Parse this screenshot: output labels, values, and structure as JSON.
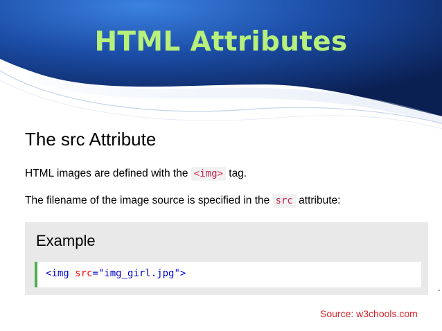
{
  "slide": {
    "title": "HTML Attributes",
    "source": "Source: w3chools.com",
    "edge_mark": "-"
  },
  "content": {
    "heading": "The src Attribute",
    "para1": {
      "before": "HTML images are defined with the ",
      "code": "<img>",
      "after": " tag."
    },
    "para2": {
      "before": "The filename of the image source is specified in the ",
      "code": "src",
      "after": " attribute:"
    },
    "example": {
      "heading": "Example",
      "code": {
        "open": "<img",
        "attr": " src",
        "eq": "=",
        "value": "\"img_girl.jpg\"",
        "close": ">"
      }
    }
  },
  "colors": {
    "banner_dark": "#0d2a66",
    "banner_light": "#2f6fd0",
    "title": "#b7f07a",
    "accent_bar": "#4caf50",
    "source_text": "#d4232a"
  }
}
